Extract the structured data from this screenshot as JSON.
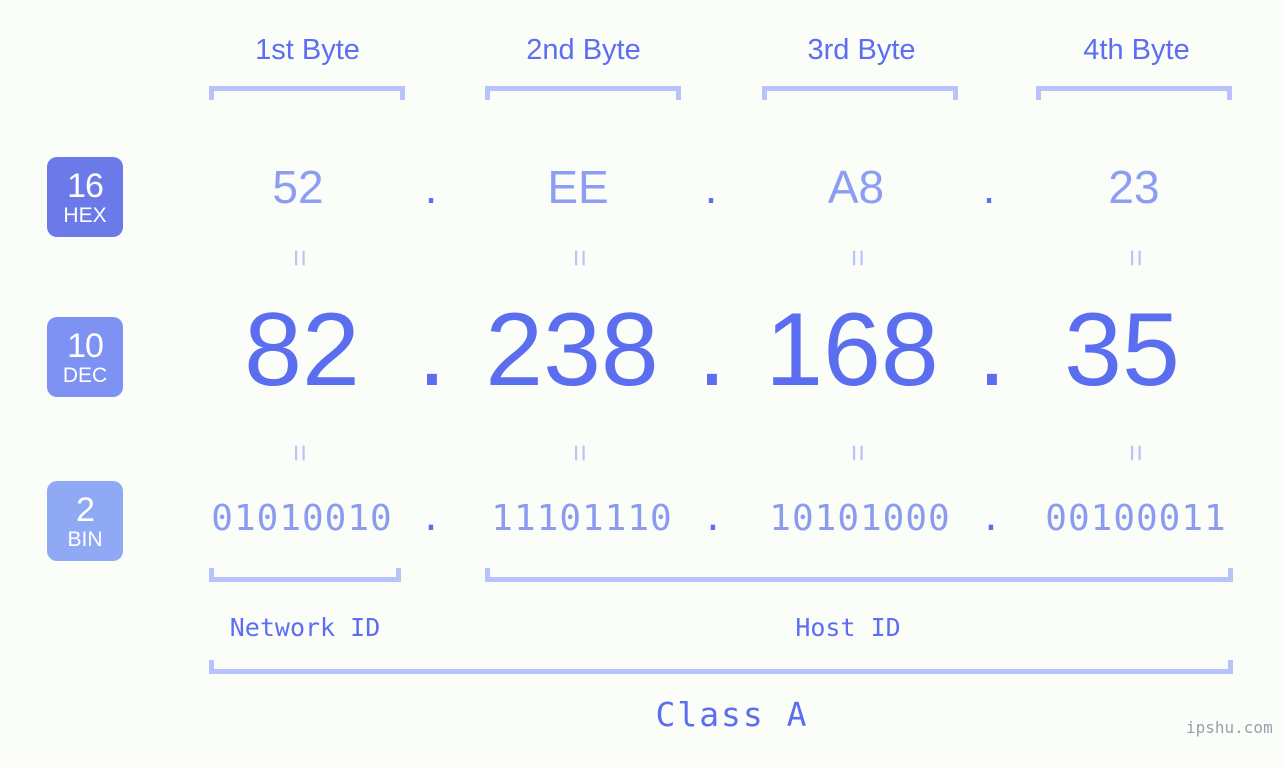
{
  "background_color": "#fbfdf8",
  "accent_colors": {
    "strong_blue": "#5b6ef0",
    "medium_blue": "#8e9df4",
    "light_blue": "#b9c3fb",
    "badge_hex": "#6b7ae8",
    "badge_dec": "#7e92f3",
    "badge_bin": "#8fa9f5"
  },
  "byte_headers": [
    {
      "label": "1st Byte"
    },
    {
      "label": "2nd Byte"
    },
    {
      "label": "3rd Byte"
    },
    {
      "label": "4th Byte"
    }
  ],
  "rows": {
    "hex": {
      "badge_number": "16",
      "badge_name": "HEX",
      "separator": ".",
      "octets": [
        "52",
        "EE",
        "A8",
        "23"
      ]
    },
    "dec": {
      "badge_number": "10",
      "badge_name": "DEC",
      "separator": ".",
      "octets": [
        "82",
        "238",
        "168",
        "35"
      ]
    },
    "bin": {
      "badge_number": "2",
      "badge_name": "BIN",
      "separator": ".",
      "octets": [
        "01010010",
        "11101110",
        "10101000",
        "00100011"
      ]
    }
  },
  "equals_mark": "=",
  "footer": {
    "network_id_label": "Network ID",
    "host_id_label": "Host ID",
    "class_label": "Class A"
  },
  "watermark": "ipshu.com"
}
